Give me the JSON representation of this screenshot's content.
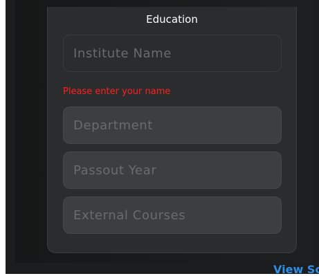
{
  "education_card": {
    "title": "Education",
    "fields": {
      "institute_name": {
        "placeholder": "Institute Name"
      },
      "department": {
        "placeholder": "Department"
      },
      "passout_year": {
        "placeholder": "Passout Year"
      },
      "external_courses": {
        "placeholder": "External Courses"
      }
    },
    "error_message": "Please enter your name"
  },
  "footer": {
    "view_link": "View Sc"
  },
  "colors": {
    "error": "#ff1f1f",
    "link": "#2e8fe6",
    "card_background": "#2b2c2d",
    "page_background": "#1c1d1e"
  }
}
